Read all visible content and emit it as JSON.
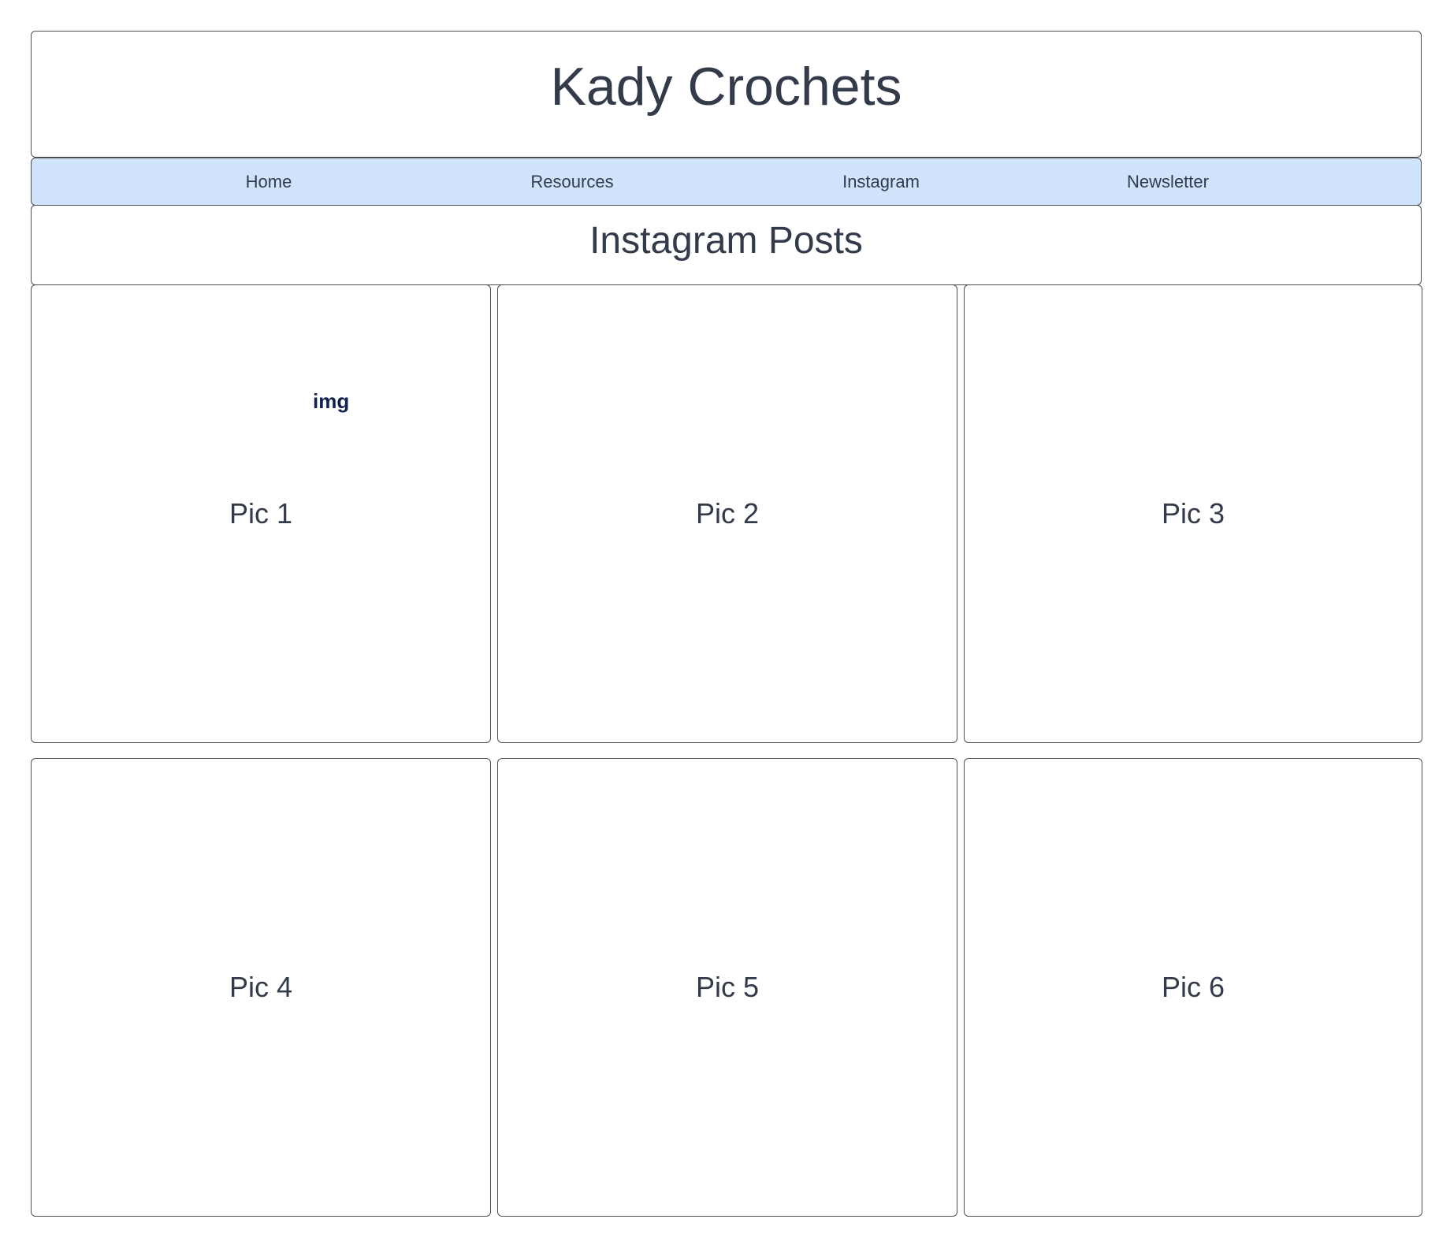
{
  "header": {
    "title": "Kady Crochets"
  },
  "nav": {
    "items": [
      {
        "label": "Home"
      },
      {
        "label": "Resources"
      },
      {
        "label": "Instagram"
      },
      {
        "label": "Newsletter"
      }
    ]
  },
  "main": {
    "heading": "Instagram Posts",
    "img_tag": "img",
    "posts": [
      {
        "label": "Pic 1"
      },
      {
        "label": "Pic 2"
      },
      {
        "label": "Pic 3"
      },
      {
        "label": "Pic 4"
      },
      {
        "label": "Pic 5"
      },
      {
        "label": "Pic 6"
      }
    ]
  },
  "colors": {
    "nav_background": "#cfe3fb",
    "text": "#333b4b",
    "img_tag": "#12204f",
    "border": "#4a4f57"
  }
}
